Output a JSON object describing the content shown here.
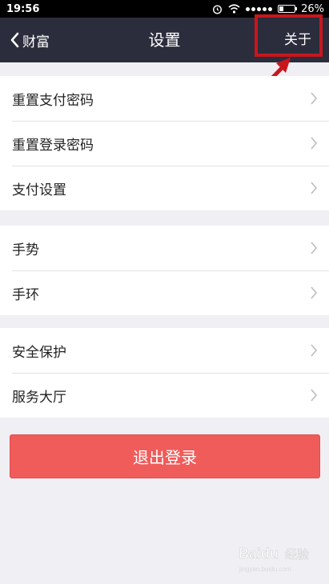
{
  "status_bar": {
    "time": "19:56",
    "battery_percent": "26%",
    "battery_level": 0.26
  },
  "nav": {
    "back_label": "财富",
    "title": "设置",
    "about_label": "关于"
  },
  "groups": [
    {
      "items": [
        {
          "label": "重置支付密码"
        },
        {
          "label": "重置登录密码"
        },
        {
          "label": "支付设置"
        }
      ]
    },
    {
      "items": [
        {
          "label": "手势"
        },
        {
          "label": "手环"
        }
      ]
    },
    {
      "items": [
        {
          "label": "安全保护"
        },
        {
          "label": "服务大厅"
        }
      ]
    }
  ],
  "logout_label": "退出登录",
  "watermark": {
    "brand": "Baidu",
    "text": "经验",
    "sub": "jingyan.baidu.com"
  },
  "colors": {
    "nav_bg": "#2b2d3c",
    "logout_bg": "#f05c5a",
    "highlight": "#c8161d",
    "page_bg": "#efeff4"
  }
}
